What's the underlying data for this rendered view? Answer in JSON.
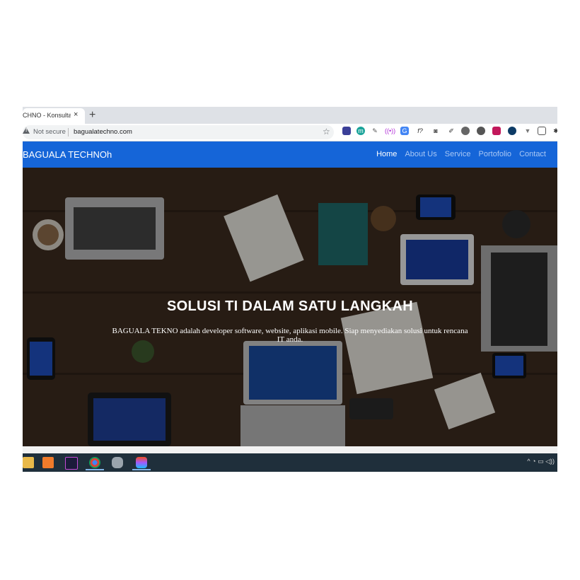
{
  "browser": {
    "tab_title": "CHNO - Konsultan",
    "tab_close": "×",
    "new_tab": "+",
    "security_label": "Not secure",
    "url": "bagualatechno.com",
    "star": "☆",
    "extension_icons": [
      "puzzle-icon",
      "m-icon",
      "eyedropper-icon",
      "wifi-icon",
      "translate-icon",
      "formula-icon",
      "camera-icon",
      "picker-icon",
      "globe-icon",
      "tomato-icon",
      "record-icon",
      "clock-icon",
      "vue-icon",
      "square-icon",
      "pin-icon"
    ]
  },
  "site": {
    "brand": "BAGUALA TECHNOh",
    "nav": [
      "Home",
      "About Us",
      "Service",
      "Portofolio",
      "Contact"
    ],
    "active_nav": "Home",
    "hero_title": "SOLUSI TI DALAM SATU LANGKAH",
    "hero_subtitle": "BAGUALA TEKNO adalah developer software, website, aplikasi mobile. Siap menyediakan solusi untuk rencana IT anda."
  },
  "taskbar": {
    "apps": [
      "file-explorer-icon",
      "xampp-icon",
      "intellij-icon",
      "chrome-icon",
      "database-icon",
      "figma-icon"
    ],
    "tray": "^ ◔ ▭ ◁))"
  },
  "colors": {
    "nav_bg": "#1565d8",
    "nav_link": "#a9c8f5",
    "taskbar_bg": "#1f2f3b"
  }
}
